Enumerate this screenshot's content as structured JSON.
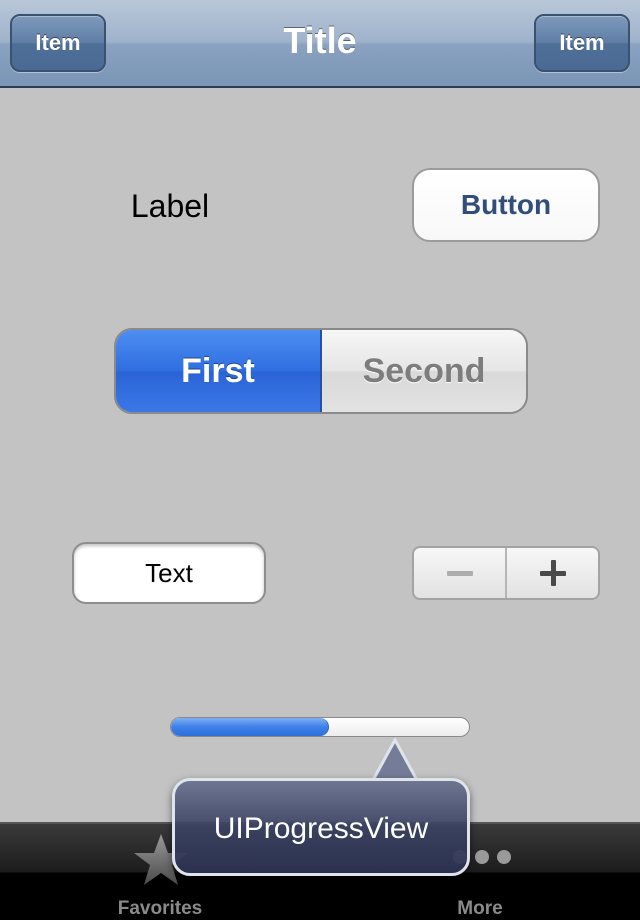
{
  "navbar": {
    "left_item": "Item",
    "title": "Title",
    "right_item": "Item"
  },
  "label": "Label",
  "button": "Button",
  "segmented": {
    "segments": [
      "First",
      "Second"
    ],
    "selected_index": 0
  },
  "textfield": {
    "value": "Text"
  },
  "stepper": {
    "minus_icon": "minus-icon",
    "plus_icon": "plus-icon"
  },
  "progress": {
    "value": 0.53
  },
  "callout": {
    "text": "UIProgressView"
  },
  "tabbar": {
    "items": [
      {
        "label": "Favorites",
        "icon": "star-icon"
      },
      {
        "label": "More",
        "icon": "more-dots-icon"
      }
    ]
  },
  "colors": {
    "navbar": "#8aa2c0",
    "background": "#c3c3c3",
    "segment_selected": "#2f6ee0",
    "button_text": "#314d7c",
    "progress_fill": "#3d80e8"
  }
}
